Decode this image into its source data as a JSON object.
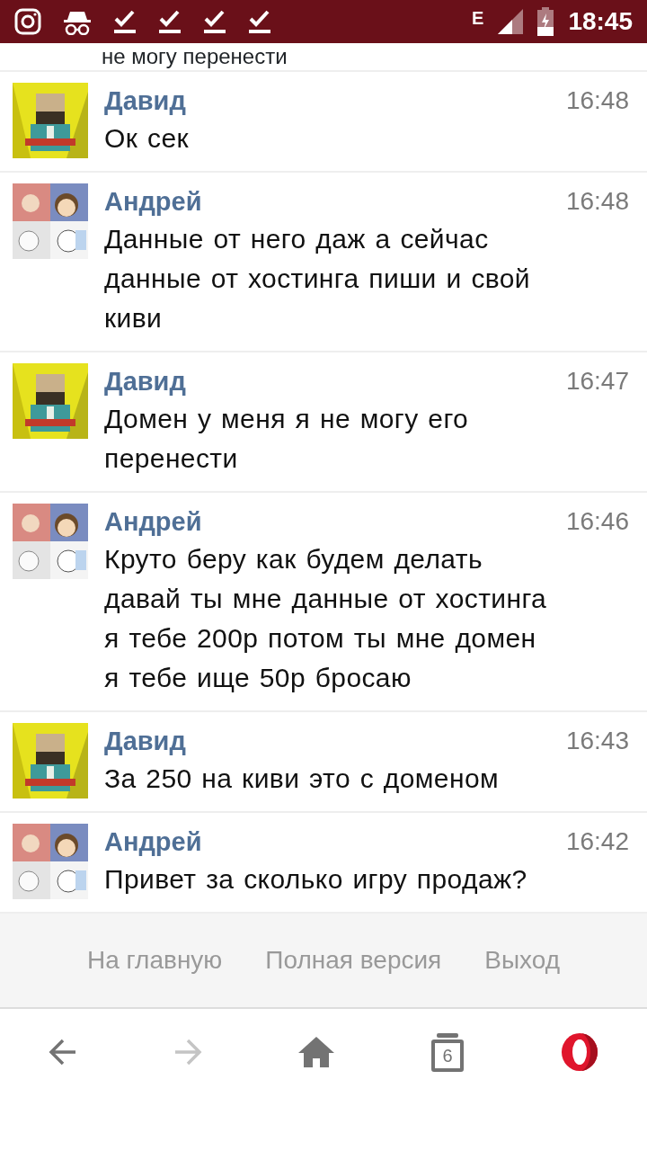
{
  "status_bar": {
    "notifications": [
      {
        "kind": "instagram"
      },
      {
        "kind": "incognito"
      },
      {
        "kind": "download"
      },
      {
        "kind": "download"
      },
      {
        "kind": "download"
      },
      {
        "kind": "download"
      }
    ],
    "network": "E",
    "time": "18:45"
  },
  "cut_message": {
    "text": "не могу перенести"
  },
  "messages": [
    {
      "author": "Давид",
      "time": "16:48",
      "text": "Ок сек"
    },
    {
      "author": "Андрей",
      "time": "16:48",
      "text": "Данные от него даж а сейчас данные от хостинга пиши и свой киви"
    },
    {
      "author": "Давид",
      "time": "16:47",
      "text": "Домен у меня я не могу его перенести"
    },
    {
      "author": "Андрей",
      "time": "16:46",
      "text": "Круто беру как будем делать давай ты мне данные от хостинга я тебе 200р потом ты мне домен я тебе ище 50р бросаю"
    },
    {
      "author": "Давид",
      "time": "16:43",
      "text": "За 250 на киви это с доменом"
    },
    {
      "author": "Андрей",
      "time": "16:42",
      "text": "Привет за сколько игру продаж?"
    }
  ],
  "footer_links": [
    "На главную",
    "Полная версия",
    "Выход"
  ],
  "browser_bar": {
    "back_disabled": false,
    "forward_disabled": true,
    "tab_count": "6"
  }
}
